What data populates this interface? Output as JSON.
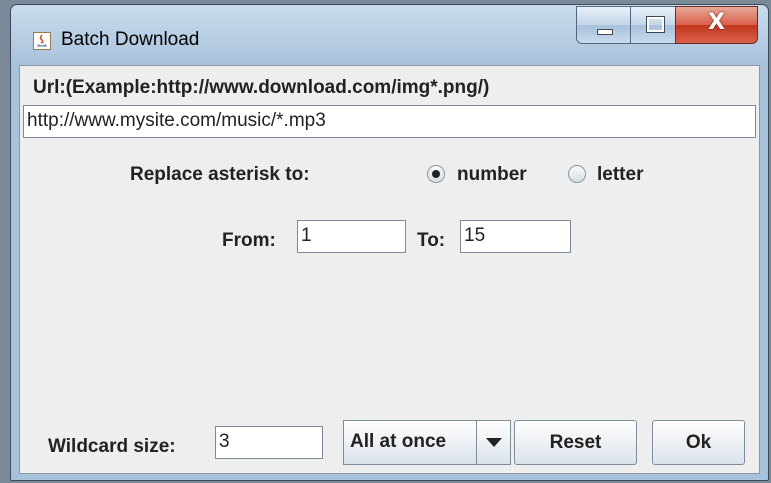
{
  "window": {
    "title": "Batch Download",
    "controls": {
      "minimize": "minimize",
      "maximize": "maximize",
      "close": "X"
    }
  },
  "url_section": {
    "label": "Url:(Example:http://www.download.com/img*.png/)",
    "value": "http://www.mysite.com/music/*.mp3"
  },
  "replace": {
    "label": "Replace asterisk to:",
    "options": [
      {
        "label": "number",
        "selected": true
      },
      {
        "label": "letter",
        "selected": false
      }
    ]
  },
  "range": {
    "from_label": "From:",
    "from_value": "1",
    "to_label": "To:",
    "to_value": "15"
  },
  "footer": {
    "wildcard_label": "Wildcard size:",
    "wildcard_value": "3",
    "mode_selected": "All at once",
    "reset_label": "Reset",
    "ok_label": "Ok"
  },
  "icons": {
    "app": "java-coffee-icon",
    "combo_arrow": "chevron-down-icon"
  },
  "colors": {
    "title_bar": "#b9cfe4",
    "close_button": "#c3361f",
    "panel_bg": "#eeeeee"
  }
}
